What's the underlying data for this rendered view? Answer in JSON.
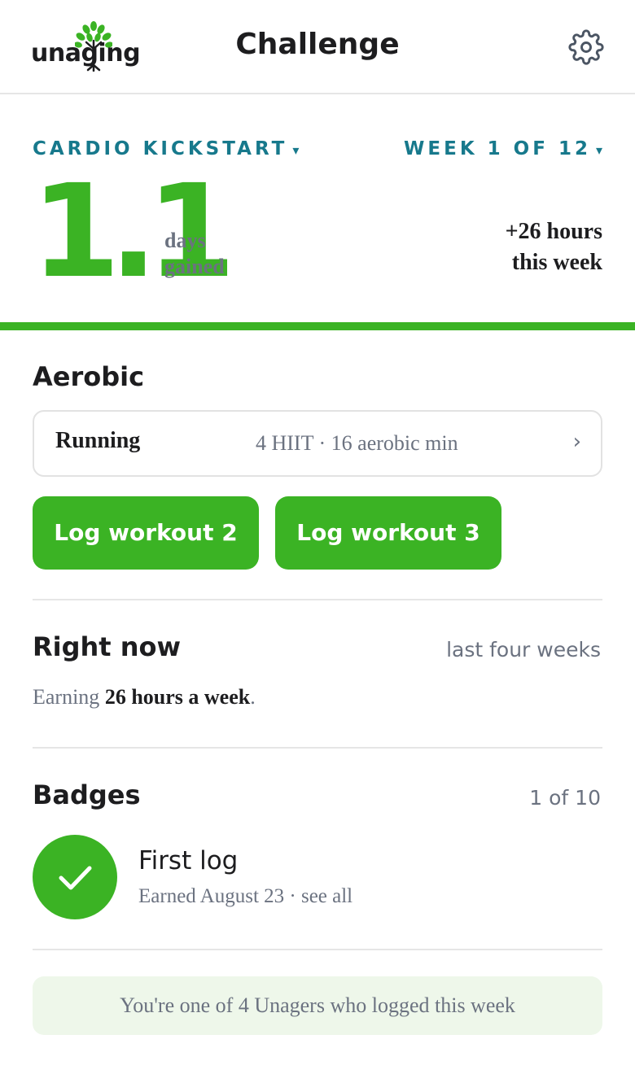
{
  "header": {
    "logo_text": "unaging",
    "title": "Challenge",
    "settings_icon": "gear-icon"
  },
  "challenge": {
    "program": "CARDIO KICKSTART",
    "week": "WEEK 1 OF 12",
    "caret": "▾",
    "days_gained": "1.1",
    "days_label_1": "days",
    "days_label_2": "gained",
    "hours_line_1": "+26 hours",
    "hours_line_2": "this week"
  },
  "aerobic": {
    "heading": "Aerobic",
    "workout_name": "Running",
    "workout_detail": "4 HIIT · 16 aerobic min",
    "chevron": "›",
    "buttons": [
      "Log workout 2",
      "Log workout 3"
    ]
  },
  "right_now": {
    "heading": "Right now",
    "period": "last four weeks",
    "prefix": "Earning ",
    "value": "26 hours a week",
    "suffix": "."
  },
  "badges": {
    "heading": "Badges",
    "count": "1 of 10",
    "badge_title": "First log",
    "earned": "Earned August 23",
    "separator": " · ",
    "see_all": "see all"
  },
  "footer_note": "You're one of 4 Unagers who logged this week",
  "colors": {
    "brand_green": "#3bb324",
    "teal": "#17798c",
    "gray_text": "#6b7280"
  }
}
